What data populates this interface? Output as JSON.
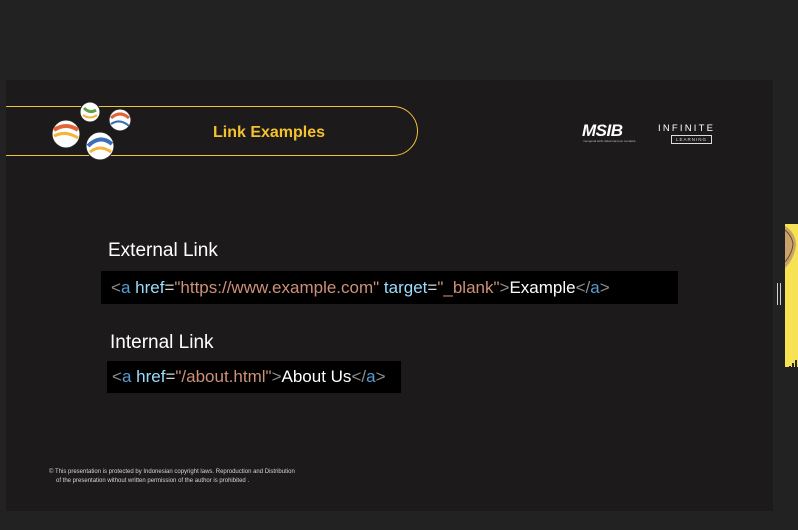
{
  "slide": {
    "title": "Link Examples",
    "logos": {
      "msib_main": "MSIB",
      "msib_sub": "mengenal lebih dekat kampus merdeka",
      "infinite": "INFINITE",
      "learning": "LEARNING"
    },
    "sections": [
      {
        "heading": "External Link",
        "code": {
          "open_lt": "<",
          "tag": "a",
          "attr1": "href",
          "eq": "=",
          "val1": "\"https://www.example.com\"",
          "attr2": "target",
          "val2": "\"_blank\"",
          "gt": ">",
          "text": "Example",
          "close_lt": "</",
          "close_tag": "a",
          "close_gt": ">"
        }
      },
      {
        "heading": "Internal Link",
        "code": {
          "open_lt": "<",
          "tag": "a",
          "attr1": "href",
          "eq": "=",
          "val1": "\"/about.html\"",
          "gt": ">",
          "text": "About Us",
          "close_lt": "</",
          "close_tag": "a",
          "close_gt": ">"
        }
      }
    ],
    "copyright_line1": "© This presentation is protected by Indonesian copyright laws. Reproduction and Distribution",
    "copyright_line2": "of the presentation without written permission of the author is prohibited ."
  },
  "colors": {
    "accent": "#f5c12e",
    "slide_bg": "#1c1a1a",
    "page_bg": "#222222"
  },
  "icons": [
    "logo-balls-icon",
    "resize-handle-icon",
    "signal-bars-icon"
  ]
}
